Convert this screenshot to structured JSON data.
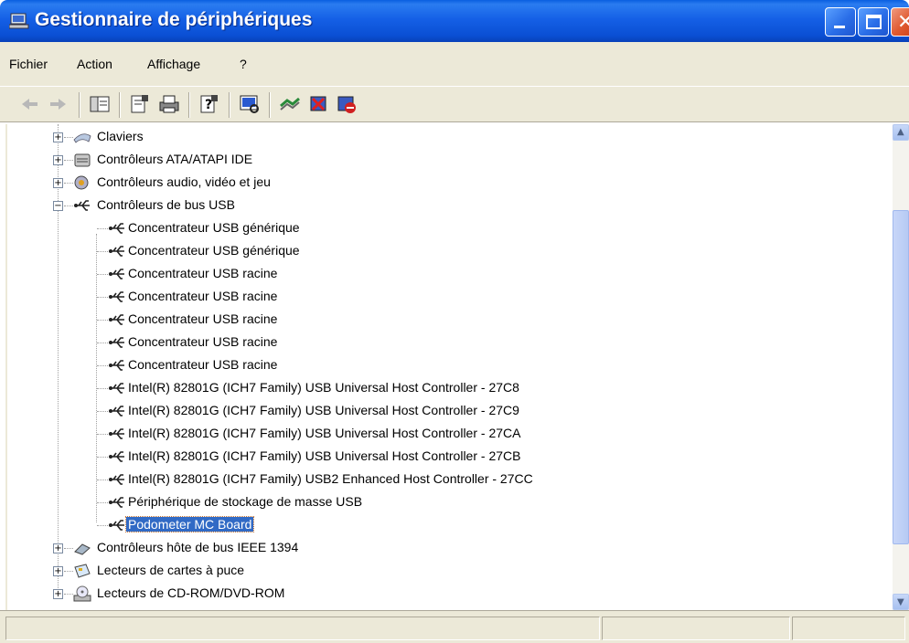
{
  "window": {
    "title": "Gestionnaire de périphériques",
    "icon": "computer-icon"
  },
  "menu": [
    "Fichier",
    "Action",
    "Affichage",
    "?"
  ],
  "toolbar": [
    "back-arrow-icon",
    "forward-arrow-icon",
    "console-tree-icon",
    "properties-icon",
    "print-icon",
    "help-icon",
    "scan-hardware-icon",
    "update-driver-icon",
    "uninstall-icon",
    "disable-icon"
  ],
  "tree": [
    {
      "label": "Claviers",
      "expanded": false,
      "icon": "keyboard-icon"
    },
    {
      "label": "Contrôleurs ATA/ATAPI IDE",
      "expanded": false,
      "icon": "ide-controller-icon"
    },
    {
      "label": "Contrôleurs audio, vidéo et jeu",
      "expanded": false,
      "icon": "audio-icon"
    },
    {
      "label": "Contrôleurs de bus USB",
      "expanded": true,
      "icon": "usb-icon",
      "children": [
        "Concentrateur USB générique",
        "Concentrateur USB générique",
        "Concentrateur USB racine",
        "Concentrateur USB racine",
        "Concentrateur USB racine",
        "Concentrateur USB racine",
        "Concentrateur USB racine",
        "Intel(R) 82801G (ICH7 Family) USB Universal Host Controller - 27C8",
        "Intel(R) 82801G (ICH7 Family) USB Universal Host Controller - 27C9",
        "Intel(R) 82801G (ICH7 Family) USB Universal Host Controller - 27CA",
        "Intel(R) 82801G (ICH7 Family) USB Universal Host Controller - 27CB",
        "Intel(R) 82801G (ICH7 Family) USB2 Enhanced Host Controller - 27CC",
        "Périphérique de stockage de masse USB",
        "Podometer MC Board"
      ],
      "selected_child": "Podometer MC Board"
    },
    {
      "label": "Contrôleurs hôte de bus IEEE 1394",
      "expanded": false,
      "icon": "ieee1394-icon"
    },
    {
      "label": "Lecteurs de cartes à puce",
      "expanded": false,
      "icon": "smartcard-reader-icon"
    },
    {
      "label": "Lecteurs de CD-ROM/DVD-ROM",
      "expanded": false,
      "icon": "cdrom-icon"
    }
  ],
  "colors": {
    "titlebar": "#1560e6",
    "selection": "#316ac5",
    "chrome": "#ece9d8"
  }
}
